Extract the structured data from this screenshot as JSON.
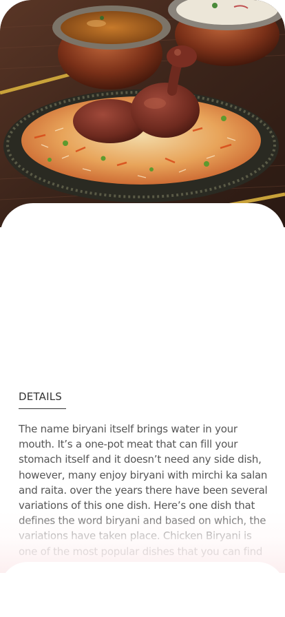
{
  "hero": {
    "image": "chicken-biryani-photo"
  },
  "details": {
    "heading": "DETAILS",
    "description": "The name biryani itself brings water in your mouth. It’s a one-pot meat that can fill your stomach itself and it doesn’t need any side dish, however, many enjoy biryani with mirchi ka salan and raita. over the years there have been several variations of this one dish. Here’s one dish that defines the word biryani and based on which, the variations have taken place. Chicken Biryani is one of the most popular dishes that you can find across the world"
  },
  "colors": {
    "heading_text": "#333333",
    "body_text": "#555555",
    "background": "#ffffff",
    "fade_tint": "#fceeef"
  }
}
